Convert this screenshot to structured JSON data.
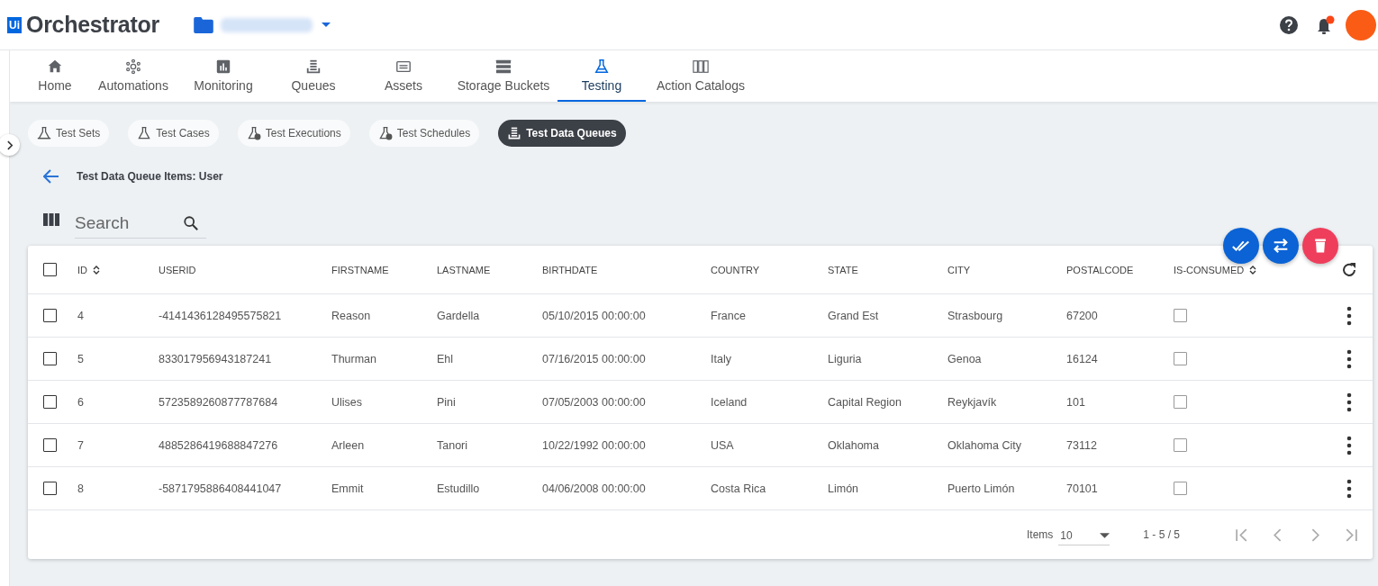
{
  "header": {
    "logo_mark": "Ui",
    "logo_text": "Orchestrator",
    "notification_unread": true
  },
  "nav": [
    {
      "label": "Home",
      "kind": "home",
      "selected": false
    },
    {
      "label": "Automations",
      "kind": "automations",
      "selected": false
    },
    {
      "label": "Monitoring",
      "kind": "monitoring",
      "selected": false
    },
    {
      "label": "Queues",
      "kind": "queues",
      "selected": false
    },
    {
      "label": "Assets",
      "kind": "assets",
      "selected": false
    },
    {
      "label": "Storage Buckets",
      "kind": "storage",
      "selected": false
    },
    {
      "label": "Testing",
      "kind": "testing",
      "selected": true
    },
    {
      "label": "Action Catalogs",
      "kind": "catalogs",
      "selected": false
    }
  ],
  "subtabs": [
    {
      "label": "Test Sets",
      "kind": "sets",
      "selected": false
    },
    {
      "label": "Test Cases",
      "kind": "cases",
      "selected": false
    },
    {
      "label": "Test Executions",
      "kind": "executions",
      "selected": false
    },
    {
      "label": "Test Schedules",
      "kind": "schedules",
      "selected": false
    },
    {
      "label": "Test Data Queues",
      "kind": "queues",
      "selected": true
    }
  ],
  "page_title": "Test Data Queue Items: User",
  "search": {
    "placeholder": "Search"
  },
  "table": {
    "all_selected": false,
    "columns": [
      {
        "label": "ID",
        "sortable": true
      },
      {
        "label": "USERID",
        "sortable": false
      },
      {
        "label": "FIRSTNAME",
        "sortable": false
      },
      {
        "label": "LASTNAME",
        "sortable": false
      },
      {
        "label": "BIRTHDATE",
        "sortable": false
      },
      {
        "label": "COUNTRY",
        "sortable": false
      },
      {
        "label": "STATE",
        "sortable": false
      },
      {
        "label": "CITY",
        "sortable": false
      },
      {
        "label": "POSTALCODE",
        "sortable": false
      },
      {
        "label": "IS-CONSUMED",
        "sortable": true
      }
    ],
    "rows": [
      {
        "selected": false,
        "cells": [
          "4",
          "-4141436128495575821",
          "Reason",
          "Gardella",
          "05/10/2015 00:00:00",
          "France",
          "Grand Est",
          "Strasbourg",
          "67200"
        ],
        "consumed": false
      },
      {
        "selected": false,
        "cells": [
          "5",
          "833017956943187241",
          "Thurman",
          "Ehl",
          "07/16/2015 00:00:00",
          "Italy",
          "Liguria",
          "Genoa",
          "16124"
        ],
        "consumed": false
      },
      {
        "selected": false,
        "cells": [
          "6",
          "5723589260877787684",
          "Ulises",
          "Pini",
          "07/05/2003 00:00:00",
          "Iceland",
          "Capital Region",
          "Reykjavík",
          "101"
        ],
        "consumed": false
      },
      {
        "selected": false,
        "cells": [
          "7",
          "4885286419688847276",
          "Arleen",
          "Tanori",
          "10/22/1992 00:00:00",
          "USA",
          "Oklahoma",
          "Oklahoma City",
          "73112"
        ],
        "consumed": false
      },
      {
        "selected": false,
        "cells": [
          "8",
          "-5871795886408441047",
          "Emmit",
          "Estudillo",
          "04/06/2008 00:00:00",
          "Costa Rica",
          "Limón",
          "Puerto Limón",
          "70101"
        ],
        "consumed": false
      }
    ]
  },
  "pager": {
    "items_label": "Items",
    "page_size": "10",
    "range": "1 - 5 / 5"
  }
}
